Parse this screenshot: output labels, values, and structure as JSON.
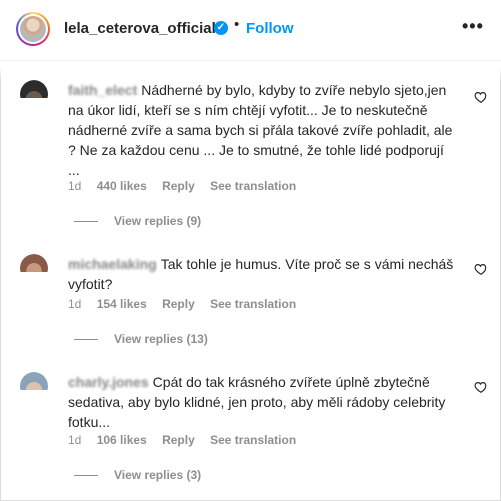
{
  "header": {
    "username": "lela_ceterova_official",
    "separator": "•",
    "follow_label": "Follow",
    "more_label": "•••"
  },
  "comments": [
    {
      "author_blurred": "faith_elect",
      "text": "Nádherné by bylo, kdyby to zvíře nebylo sjeto,jen na úkor lidí, kteří se s ním chtějí vyfotit... Je to neskutečně nádherné zvíře a sama bych si přála takové zvíře pohladit, ale ? Ne za každou cenu ... Je to smutné, že tohle lidé podporují ...",
      "time": "1d",
      "likes": "440 likes",
      "reply_label": "Reply",
      "translate_label": "See translation",
      "view_replies": "View replies (9)"
    },
    {
      "author_blurred": "michaelaking",
      "text": "Tak tohle je humus. Víte proč se s vámi necháš vyfotit?",
      "time": "1d",
      "likes": "154 likes",
      "reply_label": "Reply",
      "translate_label": "See translation",
      "view_replies": "View replies (13)"
    },
    {
      "author_blurred": "charly.jones",
      "text": "Cpát do tak krásného zvířete úplně zbytečně sedativa, aby bylo klidné, jen proto, aby měli rádoby celebrity fotku...",
      "time": "1d",
      "likes": "106 likes",
      "reply_label": "Reply",
      "translate_label": "See translation",
      "view_replies": "View replies (3)"
    }
  ],
  "colors": {
    "accent": "#0095f6",
    "text": "#262626",
    "muted": "#8e8e8e"
  },
  "icons": [
    "verified-badge-icon",
    "heart-icon",
    "more-options-icon"
  ]
}
